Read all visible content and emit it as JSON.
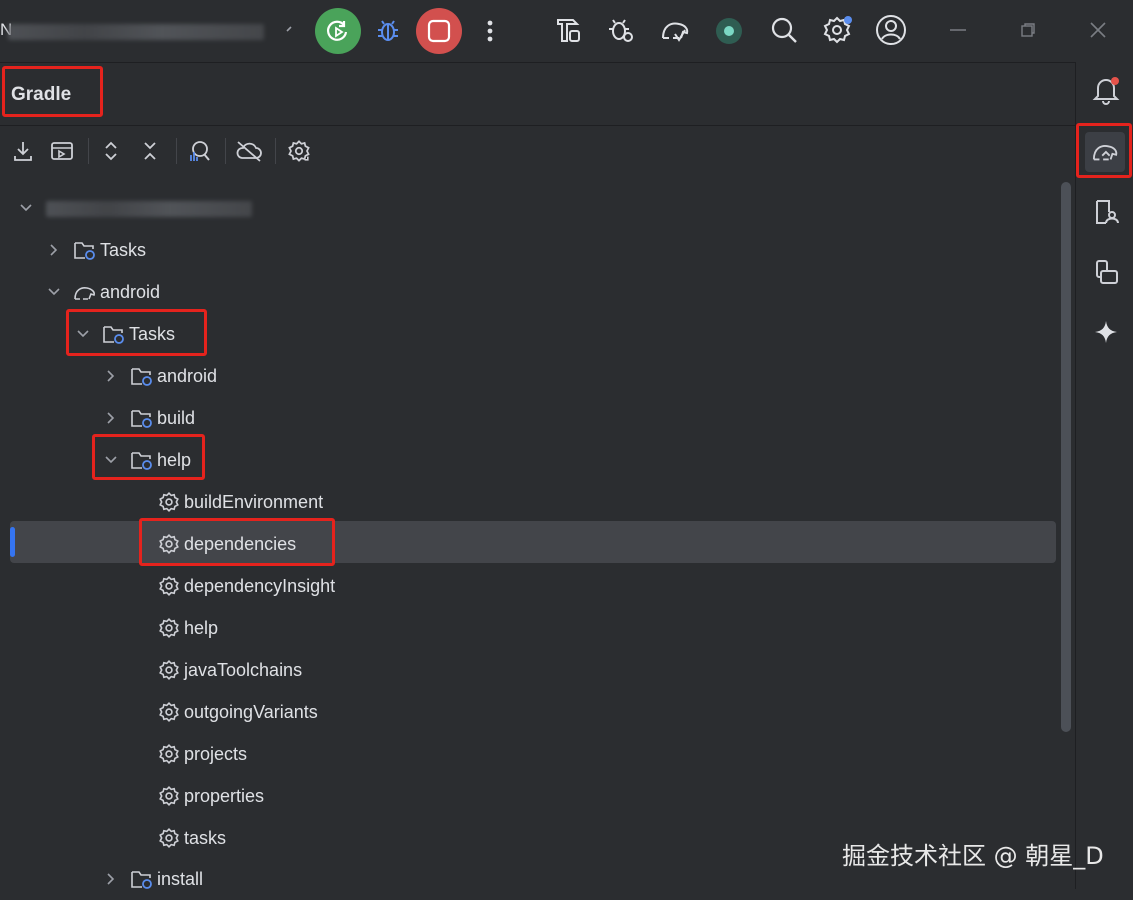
{
  "titlebar": {
    "project_name_blurred": "N"
  },
  "panel": {
    "title": "Gradle"
  },
  "toolbar": {
    "items": [
      "download-icon",
      "run-config-icon",
      "expand-all-icon",
      "collapse-all-icon",
      "analyze-dependencies-icon",
      "offline-mode-icon",
      "gradle-settings-icon"
    ]
  },
  "tree": {
    "root_blurred": "",
    "items": [
      {
        "label": "Tasks"
      },
      {
        "label": "android"
      },
      {
        "label": "Tasks"
      },
      {
        "label": "android"
      },
      {
        "label": "build"
      },
      {
        "label": "help"
      },
      {
        "label": "buildEnvironment"
      },
      {
        "label": "dependencies"
      },
      {
        "label": "dependencyInsight"
      },
      {
        "label": "help"
      },
      {
        "label": "javaToolchains"
      },
      {
        "label": "outgoingVariants"
      },
      {
        "label": "projects"
      },
      {
        "label": "properties"
      },
      {
        "label": "tasks"
      },
      {
        "label": "install"
      }
    ],
    "selected": "dependencies"
  },
  "colors": {
    "highlight": "#e5231d",
    "accent": "#3574f0",
    "run_green": "#4aa35a",
    "stop_red": "#d2504e"
  },
  "watermark": "掘金技术社区 @ 朝星_D"
}
